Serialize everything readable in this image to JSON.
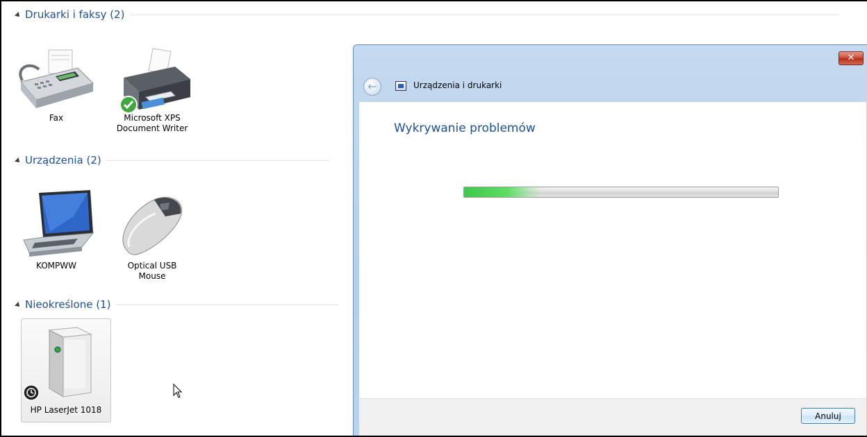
{
  "groups": [
    {
      "label": "Drukarki i faksy (2)"
    },
    {
      "label": "Urządzenia (2)"
    },
    {
      "label": "Nieokreślone (1)"
    }
  ],
  "devices": {
    "fax": {
      "name": "Fax",
      "icon": "fax-icon"
    },
    "xps": {
      "name_line1": "Microsoft XPS",
      "name_line2": "Document Writer",
      "icon": "printer-icon",
      "default_badge": "checkmark-icon"
    },
    "computer": {
      "name": "KOMPWW",
      "icon": "laptop-icon"
    },
    "mouse": {
      "name_line1": "Optical USB",
      "name_line2": "Mouse",
      "icon": "mouse-icon"
    },
    "hp": {
      "name": "HP LaserJet 1018",
      "icon": "tower-device-icon",
      "status_badge": "clock-icon"
    }
  },
  "dialog": {
    "title": "Urządzenia i drukarki",
    "close_label": "✕",
    "heading": "Wykrywanie problemów",
    "progress": 0.25,
    "cancel_label": "Anuluj"
  },
  "colors": {
    "accent_blue": "#1e4f9c",
    "progress_green": "#3fc74a",
    "close_red": "#c94934"
  }
}
